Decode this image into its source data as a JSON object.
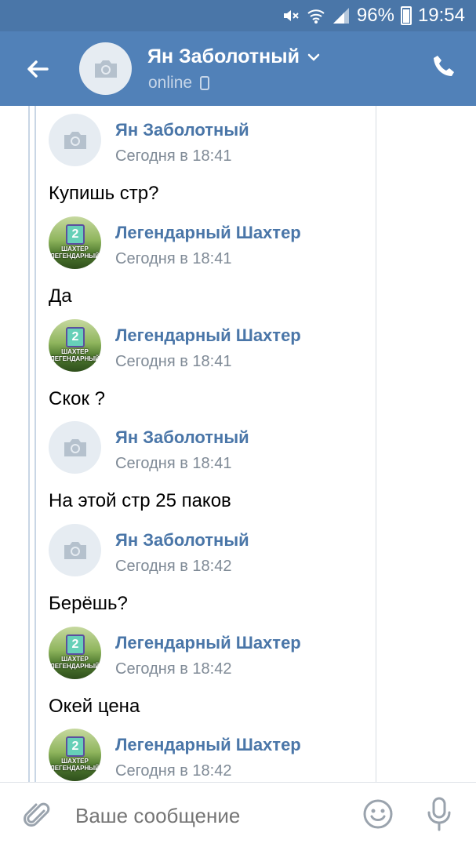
{
  "statusbar": {
    "battery": "96%",
    "time": "19:54"
  },
  "header": {
    "name": "Ян Заболотный",
    "status": "online"
  },
  "messages": [
    {
      "sender": "Ян Заболотный",
      "time": "Сегодня в 18:41",
      "text": "Купишь стр?",
      "avatar": "camera-placeholder"
    },
    {
      "sender": "Легендарный Шахтер",
      "time": "Сегодня в 18:41",
      "text": "Да",
      "avatar": "game-logo"
    },
    {
      "sender": "Легендарный Шахтер",
      "time": "Сегодня в 18:41",
      "text": "Скок ?",
      "avatar": "game-logo"
    },
    {
      "sender": "Ян Заболотный",
      "time": "Сегодня в 18:41",
      "text": "На этой стр 25 паков",
      "avatar": "camera-placeholder"
    },
    {
      "sender": "Ян Заболотный",
      "time": "Сегодня в 18:42",
      "text": "Берёшь?",
      "avatar": "camera-placeholder"
    },
    {
      "sender": "Легендарный Шахтер",
      "time": "Сегодня в 18:42",
      "text": "Окей цена",
      "avatar": "game-logo"
    },
    {
      "sender": "Легендарный Шахтер",
      "time": "Сегодня в 18:42",
      "text": "",
      "avatar": "game-logo"
    }
  ],
  "logo": {
    "line1": "ШАХТЕР",
    "line2": "ЛЕГЕНДАРНЫЙ",
    "mark": "2"
  },
  "input": {
    "placeholder": "Ваше сообщение"
  },
  "colors": {
    "header": "#5181b8",
    "statusbar": "#4a76a8",
    "sender": "#4a76a8",
    "time": "#7f8a96"
  }
}
